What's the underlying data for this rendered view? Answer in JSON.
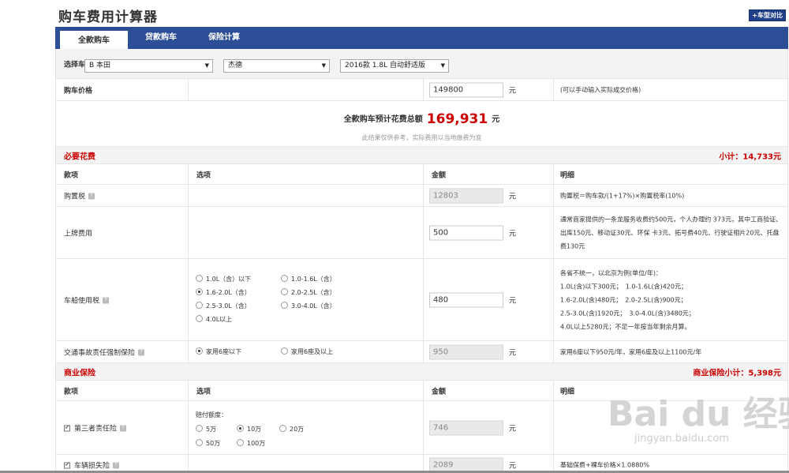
{
  "page_title": "购车费用计算器",
  "compare_link": "+车型对比",
  "tabs": [
    "全款购车",
    "贷款购车",
    "保险计算"
  ],
  "model_row": {
    "label": "选择车型",
    "brand": "B 本田",
    "series": "杰德",
    "trim": "2016款 1.8L 自动舒适版"
  },
  "price_row": {
    "label": "购车价格",
    "value": "149800",
    "unit": "元",
    "hint": "(可以手动输入实际成交价格)"
  },
  "total": {
    "prefix": "全款购车预计花费总额",
    "amount": "169,931",
    "unit": "元",
    "note": "此结果仅供参考，实际费用以当地缴费为准"
  },
  "required": {
    "title": "必要花费",
    "subtotal": "小计：14,733元",
    "headers": [
      "款项",
      "选项",
      "金额",
      "明细"
    ],
    "purchase_tax": {
      "label": "购置税",
      "value": "12803",
      "unit": "元",
      "detail": "购置税＝购车款/(1+17%)×购置税率(10%)"
    },
    "plate_fee": {
      "label": "上牌费用",
      "value": "500",
      "unit": "元",
      "detail": "通常商家提供的一条龙服务收费约500元，个人办理约 373元，其中工商验证、出库150元、移动证30元、环保 卡3元、拓号费40元、行驶证相片20元、托盘费130元"
    },
    "vehicle_tax": {
      "label": "车船使用税",
      "options": [
        "1.0L（含）以下",
        "1.0-1.6L（含）",
        "1.6-2.0L（含）",
        "2.0-2.5L（含）",
        "2.5-3.0L（含）",
        "3.0-4.0L（含）",
        "4.0L以上"
      ],
      "value": "480",
      "unit": "元",
      "detail": [
        "各省不统一，以北京为例(单位/年)：",
        "1.0L(含)以下300元；　1.0-1.6L(含)420元；",
        "1.6-2.0L(含)480元；　2.0-2.5L(含)900元；",
        "2.5-3.0L(含)1920元；　3.0-4.0L(含)3480元；",
        "4.0L以上5280元；不足一年按当年剩余月算。"
      ]
    },
    "compulsory_ins": {
      "label": "交通事故责任强制保险",
      "options": [
        "家用6座以下",
        "家用6座及以上"
      ],
      "value": "950",
      "unit": "元",
      "detail": "家用6座以下950元/年，家用6座及以上1100元/年"
    }
  },
  "commercial": {
    "title": "商业保险",
    "subtotal": "商业保险小计：5,398元",
    "headers": [
      "款项",
      "选项",
      "金额",
      "明细"
    ],
    "third_party": {
      "label": "第三者责任险",
      "options_title": "赔付额度：",
      "options": [
        "5万",
        "10万",
        "20万",
        "50万",
        "100万"
      ],
      "value": "746",
      "unit": "元"
    },
    "damage": {
      "label": "车辆损失险",
      "value": "2089",
      "unit": "元",
      "detail": "基础保费+裸车价格×1.0880%"
    }
  },
  "watermark": {
    "text": "Bai du 经验",
    "url": "jingyan.baidu.com"
  }
}
